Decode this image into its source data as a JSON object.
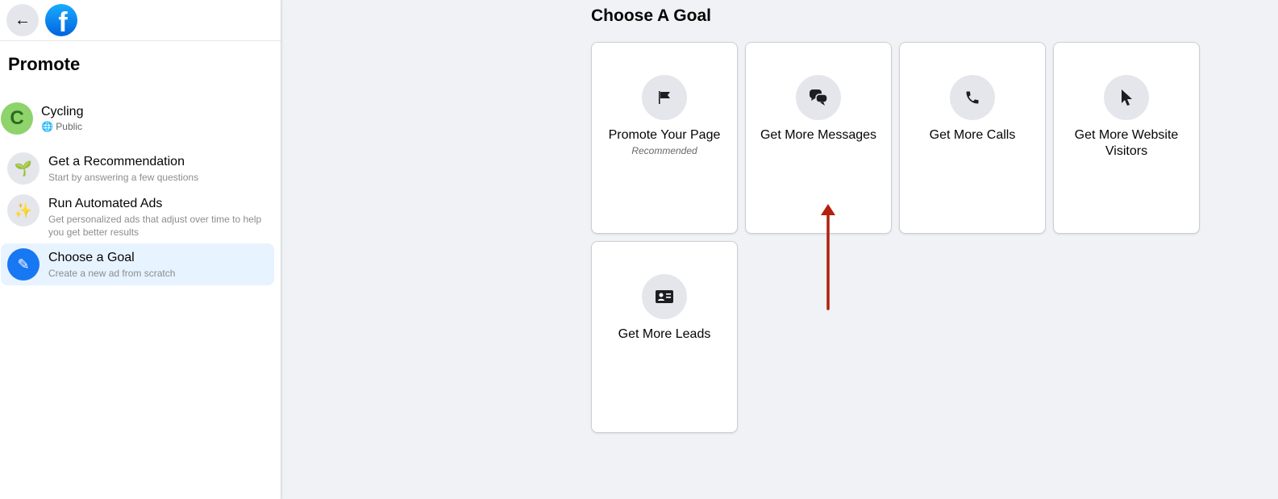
{
  "sidebar": {
    "title": "Promote",
    "page": {
      "name": "Cycling",
      "initial": "C",
      "privacy": "Public"
    },
    "items": [
      {
        "label": "Get a Recommendation",
        "sub": "Start by answering a few questions",
        "icon": "sprout-icon"
      },
      {
        "label": "Run Automated Ads",
        "sub": "Get personalized ads that adjust over time to help you get better results",
        "icon": "magic-wand-icon"
      },
      {
        "label": "Choose a Goal",
        "sub": "Create a new ad from scratch",
        "icon": "edit-icon",
        "active": true
      }
    ]
  },
  "main": {
    "title": "Choose A Goal",
    "goals": [
      {
        "label": "Promote Your Page",
        "sub": "Recommended",
        "icon": "flag-icon"
      },
      {
        "label": "Get More Messages",
        "icon": "chat-icon"
      },
      {
        "label": "Get More Calls",
        "icon": "phone-icon"
      },
      {
        "label": "Get More Website Visitors",
        "icon": "cursor-icon"
      },
      {
        "label": "Get More Leads",
        "icon": "id-card-icon"
      }
    ]
  },
  "colors": {
    "accent": "#1877f2",
    "annotation_arrow": "#b3200e"
  }
}
